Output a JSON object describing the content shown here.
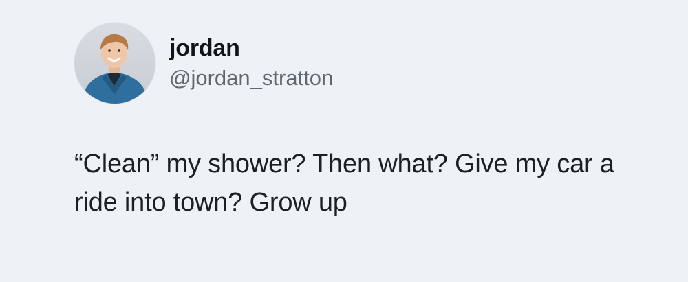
{
  "tweet": {
    "display_name": "jordan",
    "handle": "@jordan_stratton",
    "text": "“Clean” my shower? Then what? Give my car a ride into town? Grow up",
    "avatar_icon": "profile-photo-avatar"
  },
  "colors": {
    "background": "#eef1f6",
    "text": "#1c2024",
    "handle": "#5f6872"
  }
}
